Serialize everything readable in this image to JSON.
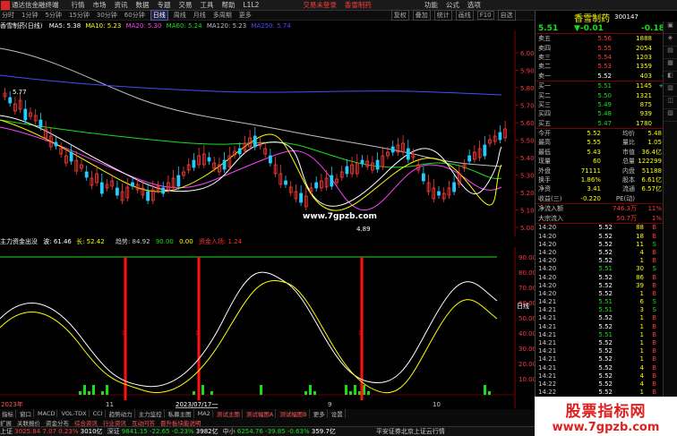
{
  "menubar": {
    "app_title": "通达信金融终端",
    "items": [
      "行情",
      "市场",
      "资讯",
      "数据",
      "专题",
      "交易",
      "工具",
      "帮助",
      "L1L2"
    ],
    "promo": [
      "交易未登录",
      "香雪制药"
    ],
    "right_items": [
      "功能",
      "公式",
      "选项"
    ]
  },
  "toolbar": {
    "periods": [
      "分时",
      "1分钟",
      "5分钟",
      "15分钟",
      "30分钟",
      "60分钟",
      "日线",
      "周线",
      "月线",
      "多周期",
      "更多"
    ],
    "active": "日线",
    "right_buttons": [
      "复权",
      "叠加",
      "统计",
      "画线",
      "F10",
      "自选"
    ]
  },
  "chart": {
    "title": "香雪制药(日线)",
    "ma_labels": [
      "MA5: 5.38",
      "MA10: 5.23",
      "MA20: 5.30",
      "MA60: 5.24",
      "MA120: 5.23",
      "MA250: 5.74"
    ],
    "ma_colors": [
      "#ffffff",
      "#ffff00",
      "#ff40ff",
      "#18e018",
      "#c0c0c0",
      "#4040ff"
    ],
    "y_ticks": [
      "6.00",
      "5.90",
      "5.80",
      "5.70",
      "5.60",
      "5.50",
      "5.40",
      "5.30",
      "5.20",
      "5.10",
      "5.00"
    ],
    "high_label": "5.77",
    "low_label": "4.89",
    "watermark_url": "www.7gpzb.com"
  },
  "indicator": {
    "title": "主力资金出没",
    "values": [
      "波: 61.46",
      "长: 52.42",
      "趋势: 84.92",
      "90.00",
      "0.00",
      "资金入场: 1.24"
    ],
    "y_ticks": [
      "90.00",
      "80.00",
      "70.00",
      "60.00",
      "50.00",
      "40.00",
      "30.00",
      "20.00",
      "10.00"
    ],
    "x_labels": [
      "2023年",
      "11",
      "2023/07/17一",
      "9",
      "10"
    ],
    "flag": "日线",
    "marker": "买"
  },
  "bottom_tabs": [
    "指标",
    "窗口",
    "MACD",
    "VOL-TDX",
    "CCI",
    "趋势动力",
    "主力监控",
    "私募主图",
    "MA2",
    "测试主图",
    "测试幅图A",
    "测试幅图B",
    "更多",
    "设置"
  ],
  "bottom_tabs2": [
    "扩展",
    "关联报价",
    "资金分布",
    "综合资讯",
    "行业资讯",
    "互动问答",
    "晋升板块能说明"
  ],
  "right": {
    "stock_name": "香雪制药",
    "code": "300147",
    "price": "5.51",
    "change": "▼-0.01",
    "pct": "-0.18%",
    "asks": [
      {
        "label": "卖五",
        "price": "5.56",
        "vol": "1888",
        "d": ""
      },
      {
        "label": "卖四",
        "price": "5.55",
        "vol": "2054",
        "d": ""
      },
      {
        "label": "卖三",
        "price": "5.54",
        "vol": "1203",
        "d": ""
      },
      {
        "label": "卖二",
        "price": "5.53",
        "vol": "1359",
        "d": ""
      },
      {
        "label": "卖一",
        "price": "5.52",
        "vol": "403",
        "d": "-42"
      }
    ],
    "bids": [
      {
        "label": "买一",
        "price": "5.51",
        "vol": "1145",
        "d": "+13"
      },
      {
        "label": "买二",
        "price": "5.50",
        "vol": "1321",
        "d": ""
      },
      {
        "label": "买三",
        "price": "5.49",
        "vol": "875",
        "d": ""
      },
      {
        "label": "买四",
        "price": "5.48",
        "vol": "939",
        "d": ""
      },
      {
        "label": "买五",
        "price": "5.47",
        "vol": "1780",
        "d": ""
      }
    ],
    "stats": [
      {
        "l1": "今开",
        "v1": "5.52",
        "l2": "均价",
        "v2": "5.48"
      },
      {
        "l1": "最高",
        "v1": "5.55",
        "l2": "量比",
        "v2": "1.05"
      },
      {
        "l1": "最低",
        "v1": "5.43",
        "l2": "市值",
        "v2": "36.4亿"
      },
      {
        "l1": "现量",
        "v1": "60",
        "l2": "总量",
        "v2": "122299"
      },
      {
        "l1": "外盘",
        "v1": "71111",
        "l2": "内盘",
        "v2": "51188"
      },
      {
        "l1": "换手",
        "v1": "1.86%",
        "l2": "股本",
        "v2": "6.61亿"
      },
      {
        "l1": "净资",
        "v1": "3.41",
        "l2": "流通",
        "v2": "6.57亿"
      },
      {
        "l1": "收益(三)",
        "v1": "-0.220",
        "l2": "PE(动)",
        "v2": ""
      }
    ],
    "flows": [
      {
        "label": "净流入额",
        "value": "746.3万",
        "pct": "11%"
      },
      {
        "label": "大宗流入",
        "value": "50.7万",
        "pct": "1%"
      }
    ],
    "ticks": [
      {
        "t": "14:20",
        "p": "5.52",
        "v": "88",
        "d": "B"
      },
      {
        "t": "14:20",
        "p": "5.52",
        "v": "18",
        "d": "B"
      },
      {
        "t": "14:20",
        "p": "5.52",
        "v": "11",
        "d": "S"
      },
      {
        "t": "14:20",
        "p": "5.52",
        "v": "4",
        "d": "B"
      },
      {
        "t": "14:20",
        "p": "5.52",
        "v": "1",
        "d": "B"
      },
      {
        "t": "14:20",
        "p": "5.51",
        "v": "30",
        "d": "S"
      },
      {
        "t": "14:20",
        "p": "5.52",
        "v": "86",
        "d": "B"
      },
      {
        "t": "14:20",
        "p": "5.52",
        "v": "39",
        "d": "B"
      },
      {
        "t": "14:20",
        "p": "5.52",
        "v": "1",
        "d": "B"
      },
      {
        "t": "14:21",
        "p": "5.51",
        "v": "6",
        "d": "S"
      },
      {
        "t": "14:21",
        "p": "5.51",
        "v": "3",
        "d": "S"
      },
      {
        "t": "14:21",
        "p": "5.52",
        "v": "1",
        "d": "B"
      },
      {
        "t": "14:21",
        "p": "5.52",
        "v": "1",
        "d": "B"
      },
      {
        "t": "14:21",
        "p": "5.51",
        "v": "1",
        "d": "B"
      },
      {
        "t": "14:21",
        "p": "5.52",
        "v": "1",
        "d": "B"
      },
      {
        "t": "14:21",
        "p": "5.52",
        "v": "1",
        "d": "B"
      },
      {
        "t": "14:21",
        "p": "5.52",
        "v": "1",
        "d": "B"
      },
      {
        "t": "14:21",
        "p": "5.52",
        "v": "4",
        "d": "B"
      },
      {
        "t": "14:21",
        "p": "5.52",
        "v": "4",
        "d": "B"
      },
      {
        "t": "14:22",
        "p": "5.52",
        "v": "4",
        "d": "B"
      },
      {
        "t": "14:22",
        "p": "5.52",
        "v": "1",
        "d": "B"
      },
      {
        "t": "14:22",
        "p": "5.51",
        "v": "1",
        "d": "B"
      }
    ]
  },
  "statusbar": [
    {
      "name": "上证",
      "v": "3025.84",
      "c": "7.07",
      "p": "0.23%",
      "a": "3010亿",
      "color": "red"
    },
    {
      "name": "深证",
      "v": "9841.15",
      "c": "-22.65",
      "p": "-0.23%",
      "a": "3982亿",
      "color": "grn"
    },
    {
      "name": "中小",
      "v": "6254.76",
      "c": "-39.85",
      "p": "-0.63%",
      "a": "359.7亿",
      "color": "grn"
    }
  ],
  "status_right": "平安证券北京上证云行情",
  "big_watermark": {
    "line1": "股票指标网",
    "line2": "www.7gpzb.com"
  }
}
